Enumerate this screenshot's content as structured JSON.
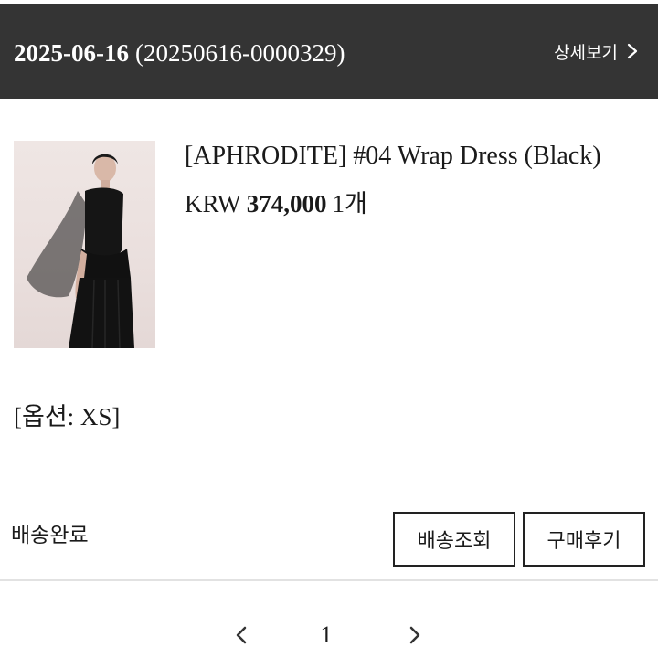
{
  "order": {
    "date": "2025-06-16",
    "order_number": "(20250616-0000329)",
    "detail_link_label": "상세보기"
  },
  "product": {
    "name": "[APHRODITE] #04 Wrap Dress (Black)",
    "currency": "KRW",
    "price": "374,000",
    "quantity": "1개",
    "image_icon": "product-photo"
  },
  "option": "[옵션: XS]",
  "status": "배송완료",
  "buttons": {
    "track": "배송조회",
    "review": "구매후기"
  },
  "pagination": {
    "current_page": "1"
  },
  "colors": {
    "header_bg": "#343434",
    "header_text": "#ffffff",
    "text": "#1a1a1a",
    "button_border": "#222222"
  }
}
